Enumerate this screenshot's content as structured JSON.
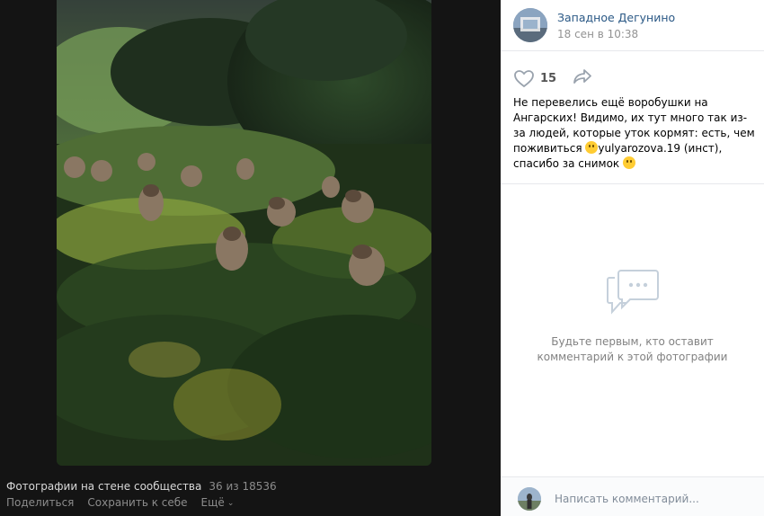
{
  "photo": {
    "alt_icon": "photo-sparrows-on-bushes"
  },
  "footer": {
    "album_title": "Фотографии на стене сообщества",
    "counter": "36 из 18536",
    "share_label": "Поделиться",
    "save_label": "Сохранить к себе",
    "more_label": "Ещё"
  },
  "post": {
    "author": "Западное Дегунино",
    "date": "18 сен в 10:38",
    "likes": "15",
    "caption_part1": "Не перевелись ещё воробушки на Ангарских! Видимо, их тут много так из-за людей, которые уток кормят: есть, чем поживиться ",
    "caption_part2": "yulyarozova.19 (инст), спасибо за снимок "
  },
  "comments": {
    "empty_text": "Будьте первым, кто оставит комментарий к этой фотографии",
    "input_placeholder": "Написать комментарий..."
  },
  "colors": {
    "link": "#2a5885",
    "icon": "#99a2ad",
    "background": "#141414"
  }
}
